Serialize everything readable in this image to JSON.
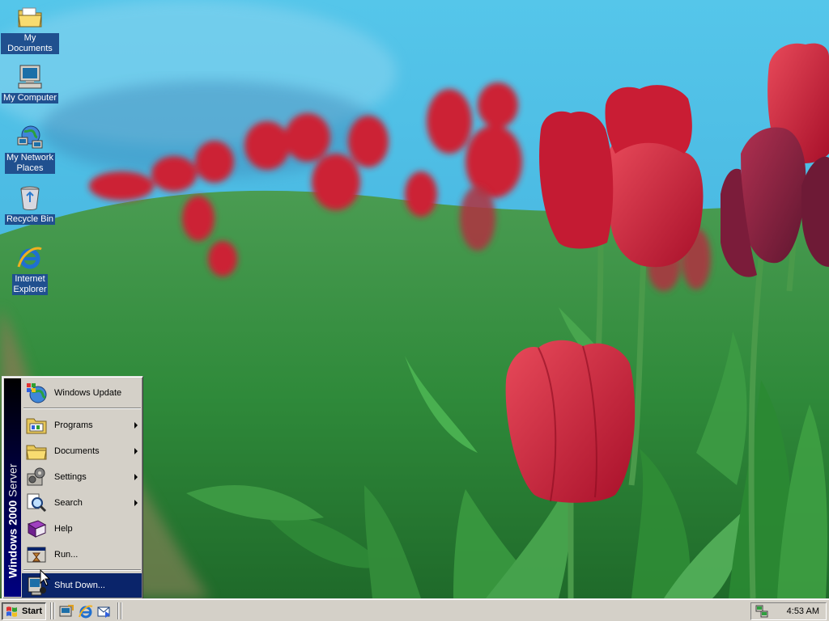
{
  "desktop": {
    "icons": [
      {
        "label": "My Documents",
        "icon": "folder-documents-icon"
      },
      {
        "label": "My Computer",
        "icon": "computer-icon"
      },
      {
        "label": "My Network\nPlaces",
        "icon": "network-places-icon"
      },
      {
        "label": "Recycle Bin",
        "icon": "recycle-bin-icon"
      },
      {
        "label": "Internet\nExplorer",
        "icon": "internet-explorer-icon"
      }
    ]
  },
  "start_menu": {
    "banner_bold": "Windows 2000",
    "banner_light": " Server",
    "items": [
      {
        "label": "Windows Update",
        "icon": "windows-update-icon",
        "submenu": false
      },
      {
        "label": "Programs",
        "icon": "programs-icon",
        "submenu": true
      },
      {
        "label": "Documents",
        "icon": "documents-icon",
        "submenu": true
      },
      {
        "label": "Settings",
        "icon": "settings-icon",
        "submenu": true
      },
      {
        "label": "Search",
        "icon": "search-icon",
        "submenu": true
      },
      {
        "label": "Help",
        "icon": "help-icon",
        "submenu": false
      },
      {
        "label": "Run...",
        "icon": "run-icon",
        "submenu": false
      },
      {
        "label": "Shut Down...",
        "icon": "shut-down-icon",
        "submenu": false,
        "highlighted": true
      }
    ]
  },
  "taskbar": {
    "start_label": "Start",
    "quick_launch": [
      "show-desktop-icon",
      "internet-explorer-icon",
      "outlook-express-icon"
    ],
    "tray_icon": "network-connection-icon",
    "clock": "4:53 AM"
  },
  "colors": {
    "highlight": "#0a246a",
    "face": "#d4d0c8",
    "desktop_label_bg": "#20508f"
  }
}
